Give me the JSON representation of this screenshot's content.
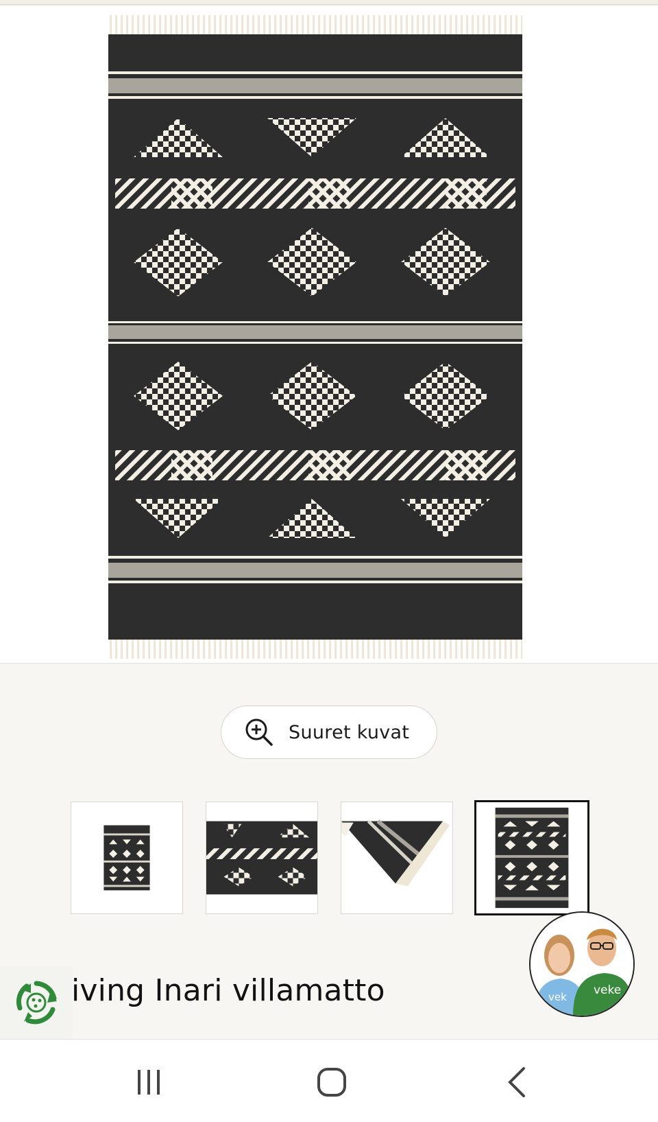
{
  "gallery": {
    "zoom_button_label": "Suuret kuvat",
    "thumbnails": [
      {
        "name": "thumb-rug-full",
        "active": false
      },
      {
        "name": "thumb-rug-detail",
        "active": false
      },
      {
        "name": "thumb-rug-corner",
        "active": false
      },
      {
        "name": "thumb-rug-pattern",
        "active": true
      }
    ]
  },
  "product": {
    "title": "iving Inari villamatto"
  },
  "chat": {
    "avatar_label": "veke",
    "shirt_text_left": "vek",
    "shirt_text_right": "veke"
  },
  "colors": {
    "rug_dark": "#2e2d2d",
    "rug_cream": "#f4efe4",
    "recycle_green": "#2f8a3a"
  },
  "navbar": {
    "icons": [
      "recent-apps-icon",
      "home-icon",
      "back-icon"
    ]
  }
}
